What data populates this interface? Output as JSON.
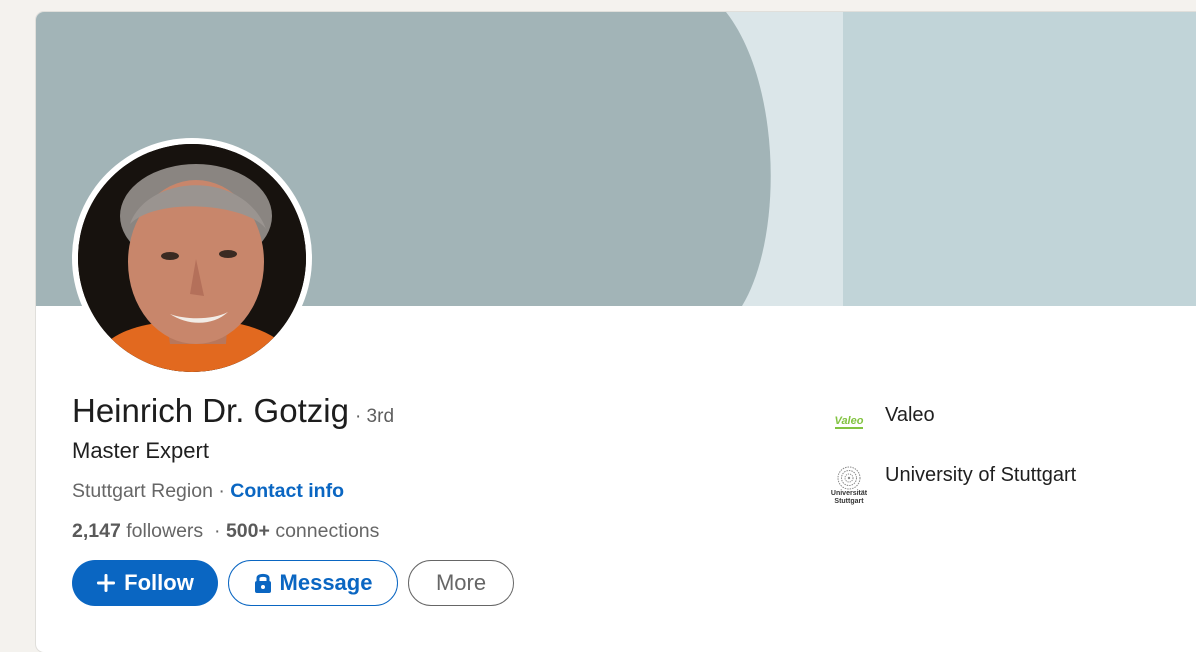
{
  "profile": {
    "name": "Heinrich Dr. Gotzig",
    "degree": "· 3rd",
    "headline": "Master Expert",
    "location": "Stuttgart Region",
    "separator": " · ",
    "contact_info": "Contact info",
    "followers_count": "2,147",
    "followers_label": "followers",
    "connections_prefix": "·",
    "connections_count": "500+",
    "connections_label": "connections"
  },
  "actions": {
    "follow": "Follow",
    "message": "Message",
    "more": "More"
  },
  "organizations": [
    {
      "name": "Valeo",
      "logo_text": "Valeo",
      "icon": "valeo-logo"
    },
    {
      "name": "University of Stuttgart",
      "logo_text_line1": "Universität",
      "logo_text_line2": "Stuttgart",
      "icon": "university-stuttgart-logo"
    }
  ],
  "colors": {
    "accent": "#0a66c2",
    "banner_dark": "#a2b4b7",
    "banner_light": "#dbe6e9",
    "banner_mid": "#c1d4d8",
    "valeo_green": "#82c341"
  }
}
